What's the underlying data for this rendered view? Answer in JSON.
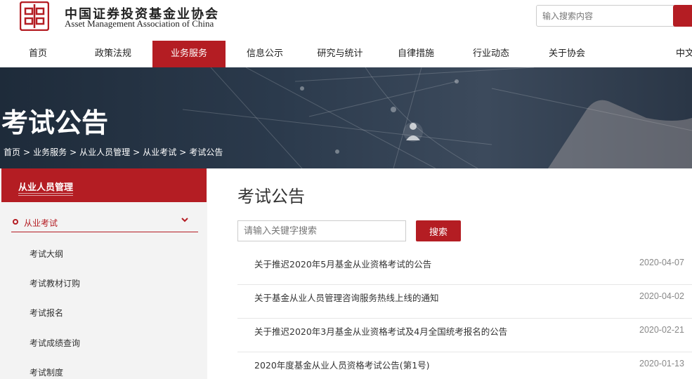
{
  "header": {
    "brand_cn": "中国证券投资基金业协会",
    "brand_en": "Asset Management Association of China",
    "search_placeholder": "输入搜索内容"
  },
  "nav": {
    "items": [
      {
        "label": "首页"
      },
      {
        "label": "政策法规"
      },
      {
        "label": "业务服务"
      },
      {
        "label": "信息公示"
      },
      {
        "label": "研究与统计"
      },
      {
        "label": "自律措施"
      },
      {
        "label": "行业动态"
      },
      {
        "label": "关于协会"
      },
      {
        "label": "中文"
      }
    ],
    "active": "业务服务"
  },
  "banner": {
    "title": "考试公告",
    "breadcrumb": [
      "首页",
      ">",
      "业务服务",
      ">",
      "从业人员管理",
      ">",
      "从业考试",
      ">",
      "考试公告"
    ]
  },
  "sidebar": {
    "title": "从业人员管理",
    "group": "从业考试",
    "items": [
      "考试大纲",
      "考试教材订购",
      "考试报名",
      "考试成绩查询",
      "考试制度"
    ]
  },
  "main": {
    "title": "考试公告",
    "search_placeholder": "请输入关键字搜索",
    "search_button": "搜索",
    "news": [
      {
        "title": "关于推迟2020年5月基金从业资格考试的公告",
        "date": "2020-04-07"
      },
      {
        "title": "关于基金从业人员管理咨询服务热线上线的通知",
        "date": "2020-04-02"
      },
      {
        "title": "关于推迟2020年3月基金从业资格考试及4月全国统考报名的公告",
        "date": "2020-02-21"
      },
      {
        "title": "2020年度基金从业人员资格考试公告(第1号)",
        "date": "2020-01-13"
      }
    ]
  },
  "colors": {
    "accent": "#b41d23",
    "banner_dark": "#1e2b3a",
    "sidebar_bg": "#f3f3f3"
  }
}
